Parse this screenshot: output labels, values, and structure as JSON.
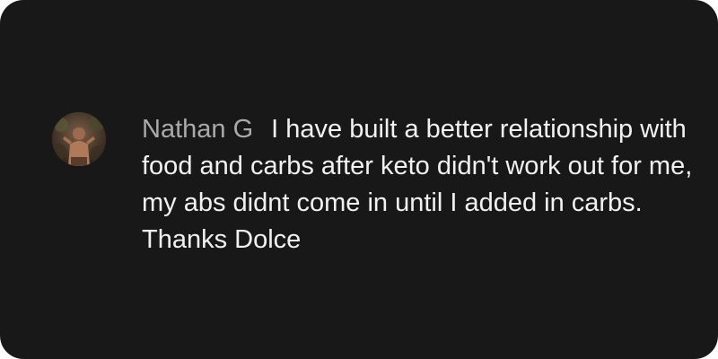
{
  "comment": {
    "author": "Nathan G",
    "text": "I have built a better relationship with food and carbs after keto didn't work out for me, my abs didnt come in until I added in carbs. Thanks Dolce",
    "avatar_icon": "user-avatar-photo"
  },
  "colors": {
    "background": "#181818",
    "author": "#aaaaaa",
    "text": "#f1f1f1"
  }
}
